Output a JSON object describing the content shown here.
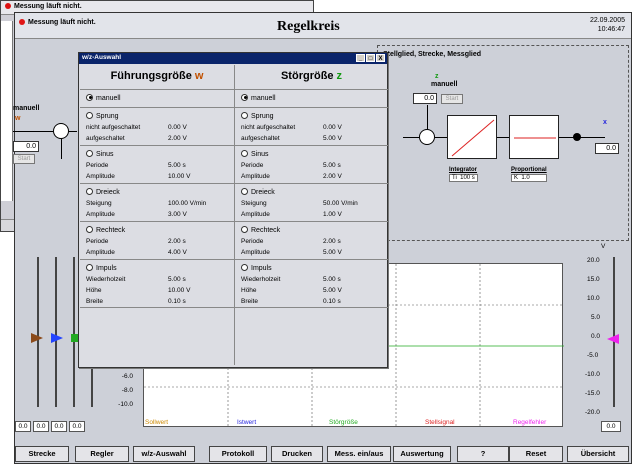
{
  "bg_window": {
    "status": "Messung läuft nicht."
  },
  "header": {
    "status": "Messung läuft nicht.",
    "title": "Regelkreis",
    "date": "22.09.2005",
    "time": "10:46:47"
  },
  "diagram": {
    "stell_title": "Stellglied, Strecke, Messglied",
    "w_label": "manuell",
    "w_symbol": "w",
    "w_value": "0.0",
    "w_start": "Start",
    "z_symbol": "z",
    "z_label": "manuell",
    "z_value": "0.0",
    "z_start": "Start",
    "x_symbol": "x",
    "x_value": "0.0",
    "integrator": {
      "name": "Integrator",
      "param": "Ti",
      "value": "100 s"
    },
    "proportional": {
      "name": "Proportional",
      "param": "K",
      "value": "1.0"
    }
  },
  "plot": {
    "left_ticks": [
      "-6.0",
      "-8.0",
      "-10.0"
    ],
    "right_unit": "V",
    "right_ticks": [
      "20.0",
      "15.0",
      "10.0",
      "5.0",
      "0.0",
      "-5.0",
      "-10.0",
      "-15.0",
      "-20.0"
    ],
    "legend": [
      {
        "label": "Sollwert",
        "color": "#cc8800"
      },
      {
        "label": "Istwert",
        "color": "#2222dd"
      },
      {
        "label": "Störgröße",
        "color": "#22aa22"
      },
      {
        "label": "Stellsignal",
        "color": "#dd2222"
      },
      {
        "label": "Regelfehler",
        "color": "#ee22ee"
      }
    ],
    "readouts": [
      "0.0",
      "0.0",
      "0.0",
      "0.0"
    ],
    "right_readout": "0.0"
  },
  "buttons": [
    "Strecke",
    "Regler",
    "w/z-Auswahl",
    "Protokoll",
    "Drucken",
    "Mess. ein/aus",
    "Auswertung",
    "?",
    "Reset",
    "Übersicht"
  ],
  "dialog": {
    "title": "w/z-Auswahl",
    "controls": [
      "_",
      "□",
      "X"
    ],
    "columns": [
      {
        "header": "Führungsgröße",
        "symbol": "w",
        "symbol_color": "#c05000",
        "sections": [
          {
            "radio": "manuell",
            "selected": true,
            "rows": []
          },
          {
            "radio": "Sprung",
            "selected": false,
            "rows": [
              [
                "nicht aufgeschaltet",
                "0.00 V"
              ],
              [
                "aufgeschaltet",
                "2.00 V"
              ]
            ]
          },
          {
            "radio": "Sinus",
            "selected": false,
            "rows": [
              [
                "Periode",
                "5.00 s"
              ],
              [
                "Amplitude",
                "10.00 V"
              ]
            ]
          },
          {
            "radio": "Dreieck",
            "selected": false,
            "rows": [
              [
                "Steigung",
                "100.00 V/min"
              ],
              [
                "Amplitude",
                "3.00 V"
              ]
            ]
          },
          {
            "radio": "Rechteck",
            "selected": false,
            "rows": [
              [
                "Periode",
                "2.00 s"
              ],
              [
                "Amplitude",
                "4.00 V"
              ]
            ]
          },
          {
            "radio": "Impuls",
            "selected": false,
            "rows": [
              [
                "Wiederholzeit",
                "5.00 s"
              ],
              [
                "Höhe",
                "10.00 V"
              ],
              [
                "Breite",
                "0.10 s"
              ]
            ]
          }
        ]
      },
      {
        "header": "Störgröße",
        "symbol": "z",
        "symbol_color": "#119911",
        "sections": [
          {
            "radio": "manuell",
            "selected": true,
            "rows": []
          },
          {
            "radio": "Sprung",
            "selected": false,
            "rows": [
              [
                "nicht aufgeschaltet",
                "0.00 V"
              ],
              [
                "aufgeschaltet",
                "5.00 V"
              ]
            ]
          },
          {
            "radio": "Sinus",
            "selected": false,
            "rows": [
              [
                "Periode",
                "5.00 s"
              ],
              [
                "Amplitude",
                "2.00 V"
              ]
            ]
          },
          {
            "radio": "Dreieck",
            "selected": false,
            "rows": [
              [
                "Steigung",
                "50.00 V/min"
              ],
              [
                "Amplitude",
                "1.00 V"
              ]
            ]
          },
          {
            "radio": "Rechteck",
            "selected": false,
            "rows": [
              [
                "Periode",
                "2.00 s"
              ],
              [
                "Amplitude",
                "5.00 V"
              ]
            ]
          },
          {
            "radio": "Impuls",
            "selected": false,
            "rows": [
              [
                "Wiederholzeit",
                "5.00 s"
              ],
              [
                "Höhe",
                "5.00 V"
              ],
              [
                "Breite",
                "0.10 s"
              ]
            ]
          }
        ]
      }
    ]
  }
}
